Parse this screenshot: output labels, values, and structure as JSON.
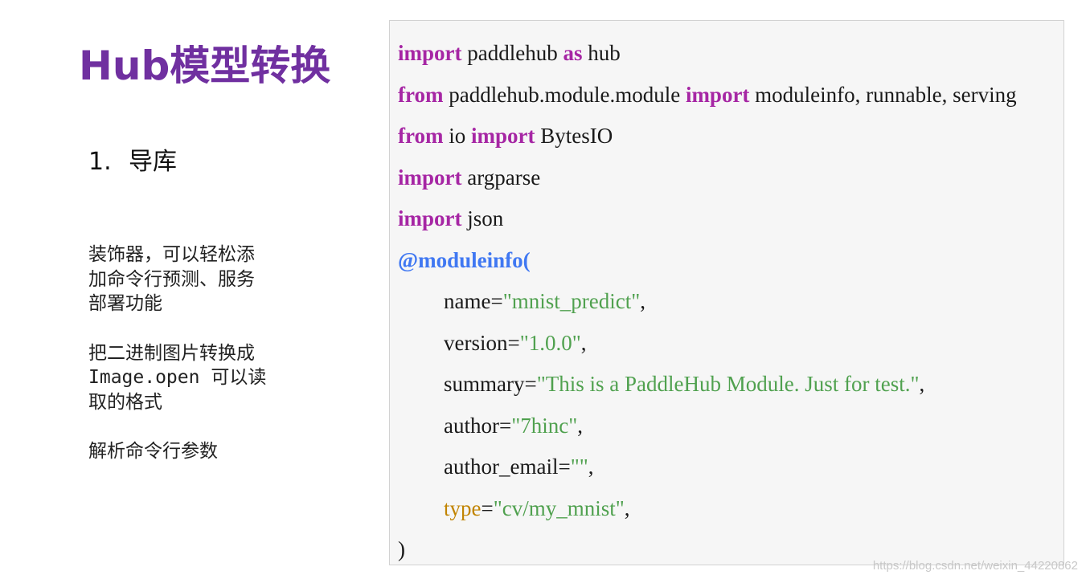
{
  "slide": {
    "title": "Hub模型转换",
    "section_number": "1.",
    "section_title": "导库",
    "notes": [
      "装饰器，可以轻松添\n加命令行预测、服务\n部署功能",
      "把二进制图片转换成\nImage.open 可以读\n取的格式",
      "解析命令行参数"
    ]
  },
  "code": {
    "lines": [
      [
        {
          "t": "import",
          "c": "kw"
        },
        {
          "t": " paddlehub ",
          "c": ""
        },
        {
          "t": "as",
          "c": "kw"
        },
        {
          "t": " hub",
          "c": ""
        }
      ],
      [
        {
          "t": "from",
          "c": "kw"
        },
        {
          "t": " paddlehub.module.module ",
          "c": ""
        },
        {
          "t": "import",
          "c": "kw"
        },
        {
          "t": " moduleinfo, runnable, serving",
          "c": ""
        }
      ],
      [
        {
          "t": "from",
          "c": "kw"
        },
        {
          "t": " io ",
          "c": ""
        },
        {
          "t": "import",
          "c": "kw"
        },
        {
          "t": " BytesIO",
          "c": ""
        }
      ],
      [
        {
          "t": "import",
          "c": "kw"
        },
        {
          "t": " argparse",
          "c": ""
        }
      ],
      [
        {
          "t": "import",
          "c": "kw"
        },
        {
          "t": " json",
          "c": ""
        }
      ],
      [
        {
          "t": "@moduleinfo(",
          "c": "dec"
        }
      ],
      [
        {
          "t": "name=",
          "c": ""
        },
        {
          "t": "\"mnist_predict\"",
          "c": "str"
        },
        {
          "t": ",",
          "c": ""
        }
      ],
      [
        {
          "t": "version=",
          "c": ""
        },
        {
          "t": "\"1.0.0\"",
          "c": "str"
        },
        {
          "t": ",",
          "c": ""
        }
      ],
      [
        {
          "t": "summary=",
          "c": ""
        },
        {
          "t": "\"This is a PaddleHub Module. Just for test.\"",
          "c": "str"
        },
        {
          "t": ",",
          "c": ""
        }
      ],
      [
        {
          "t": "author=",
          "c": ""
        },
        {
          "t": "\"7hinc\"",
          "c": "str"
        },
        {
          "t": ",",
          "c": ""
        }
      ],
      [
        {
          "t": "author_email=",
          "c": ""
        },
        {
          "t": "\"\"",
          "c": "str"
        },
        {
          "t": ",",
          "c": ""
        }
      ],
      [
        {
          "t": "type",
          "c": "typekey"
        },
        {
          "t": "=",
          "c": ""
        },
        {
          "t": "\"cv/my_mnist\"",
          "c": "str"
        },
        {
          "t": ",",
          "c": ""
        }
      ],
      [
        {
          "t": ")",
          "c": ""
        }
      ]
    ],
    "indented_lines": [
      6,
      7,
      8,
      9,
      10,
      11
    ]
  },
  "watermark": "https://blog.csdn.net/weixin_44220862",
  "colors": {
    "title": "#7030a0",
    "keyword": "#a626a4",
    "decorator": "#4078f2",
    "string": "#50a14f",
    "type_key": "#c18401",
    "code_background": "#f6f6f6"
  }
}
